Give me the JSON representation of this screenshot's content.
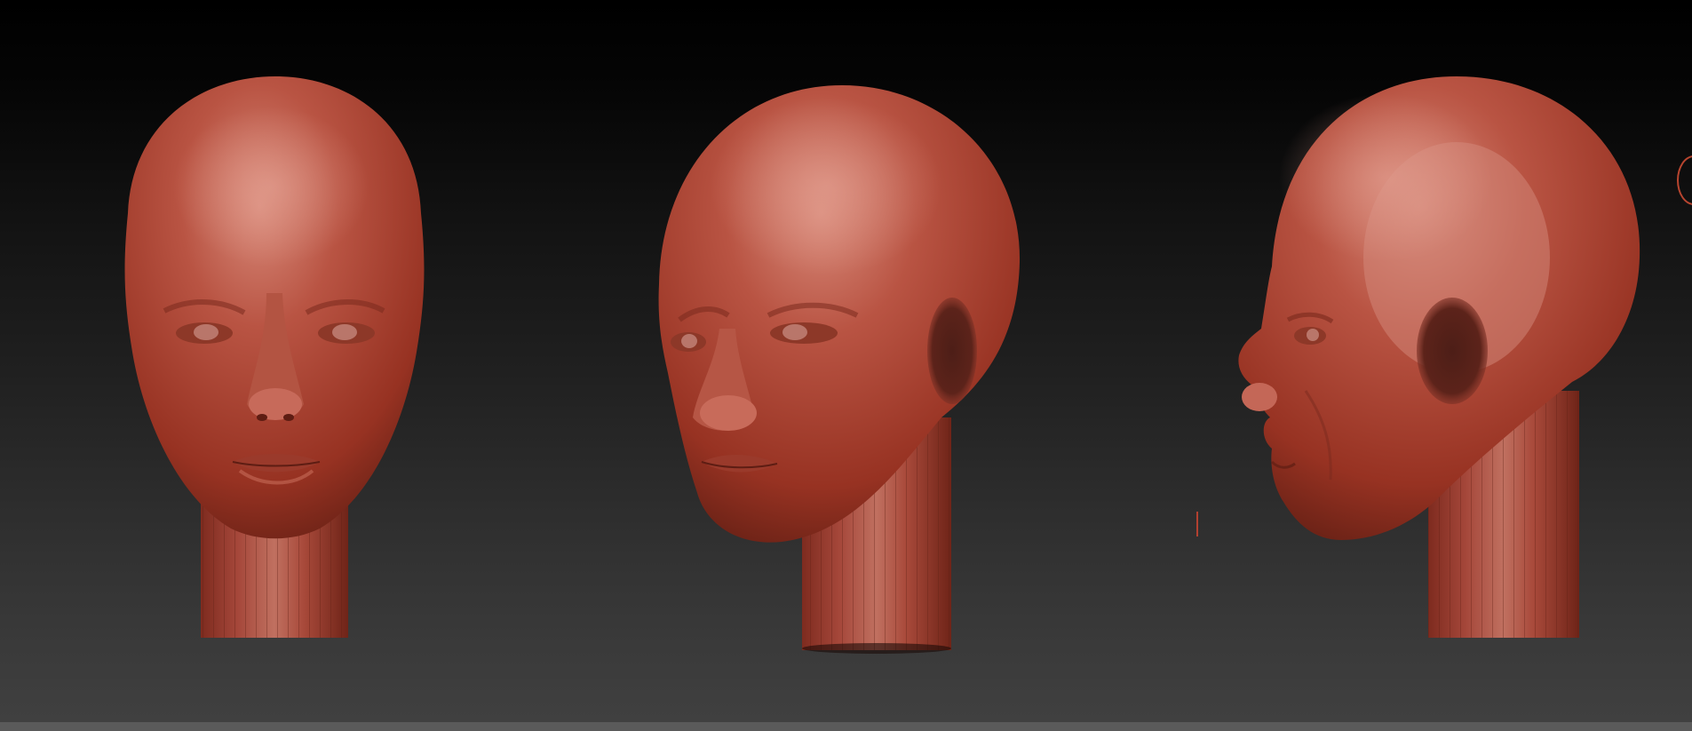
{
  "viewport": {
    "content": "zbrush-sculpt-viewport",
    "background": [
      "#000000",
      "#404040"
    ]
  },
  "material": {
    "base": "#a9432f",
    "highlight": "#cf7060",
    "shadow": "#6b2216"
  },
  "models": [
    {
      "view": "front"
    },
    {
      "view": "three-quarter"
    },
    {
      "view": "side"
    }
  ]
}
